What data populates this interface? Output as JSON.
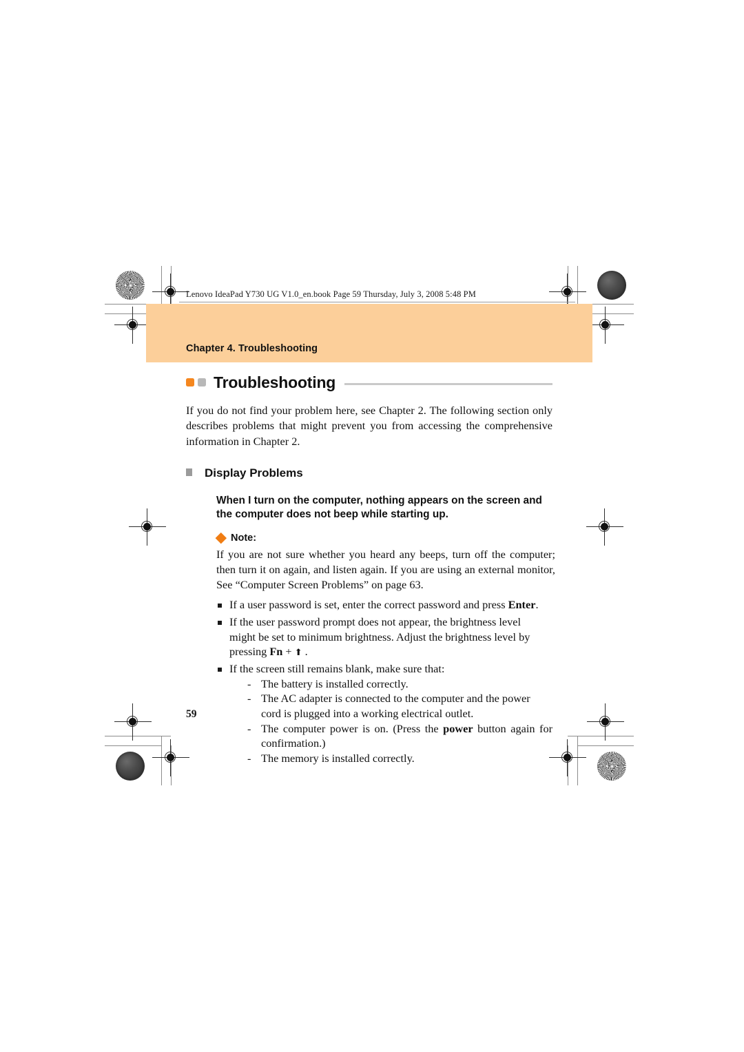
{
  "printer_header": "Lenovo IdeaPad Y730 UG V1.0_en.book  Page 59  Thursday, July 3, 2008  5:48 PM",
  "chapter_banner": {
    "label": "Chapter 4. Troubleshooting",
    "background_color": "#fccf9a"
  },
  "section": {
    "title": "Troubleshooting",
    "marker_orange_color": "#f5871f",
    "marker_gray_color": "#b8b8b8",
    "rule_color": "#c9c9c9",
    "intro": "If you do not find your problem here, see Chapter 2. The following section only describes problems that might prevent you from accessing the comprehensive information in Chapter 2."
  },
  "display_problems": {
    "heading": "Display Problems",
    "bullet_color": "#9b9b9b",
    "question": "When I turn on the computer, nothing appears on the screen and the computer does not beep while starting up.",
    "note": {
      "diamond_color": "#f07d13",
      "label": "Note:",
      "line1": "If you are not sure whether you heard any beeps, turn off the computer;",
      "line2": "then turn it on again, and listen again. If you are using an external monitor,",
      "line3": "See “Computer Screen Problems” on page 63."
    },
    "bullets": [
      {
        "lines": [
          "If a user password is set, enter the correct password and press "
        ],
        "bold_tail": "Enter",
        "tail": "."
      },
      {
        "lines": [
          "If the user password prompt does not appear, the brightness level",
          "might be set to minimum brightness. Adjust the brightness level by"
        ],
        "last_prefix": "pressing ",
        "last_bold": "Fn",
        "last_mid": " + ",
        "last_arrow": "⬆",
        "last_suffix": " ."
      },
      {
        "lines": [
          "If the screen still remains blank, make sure that:"
        ],
        "subitems": [
          {
            "text": "The battery is installed correctly."
          },
          {
            "text": "The AC adapter is connected to the computer and the power cord is plugged into a working electrical outlet."
          },
          {
            "prefix": "The computer power is on. (Press the ",
            "bold": "power",
            "suffix": " button again for confirmation.)"
          },
          {
            "text": "The memory is installed correctly."
          }
        ]
      }
    ]
  },
  "page_number": "59"
}
